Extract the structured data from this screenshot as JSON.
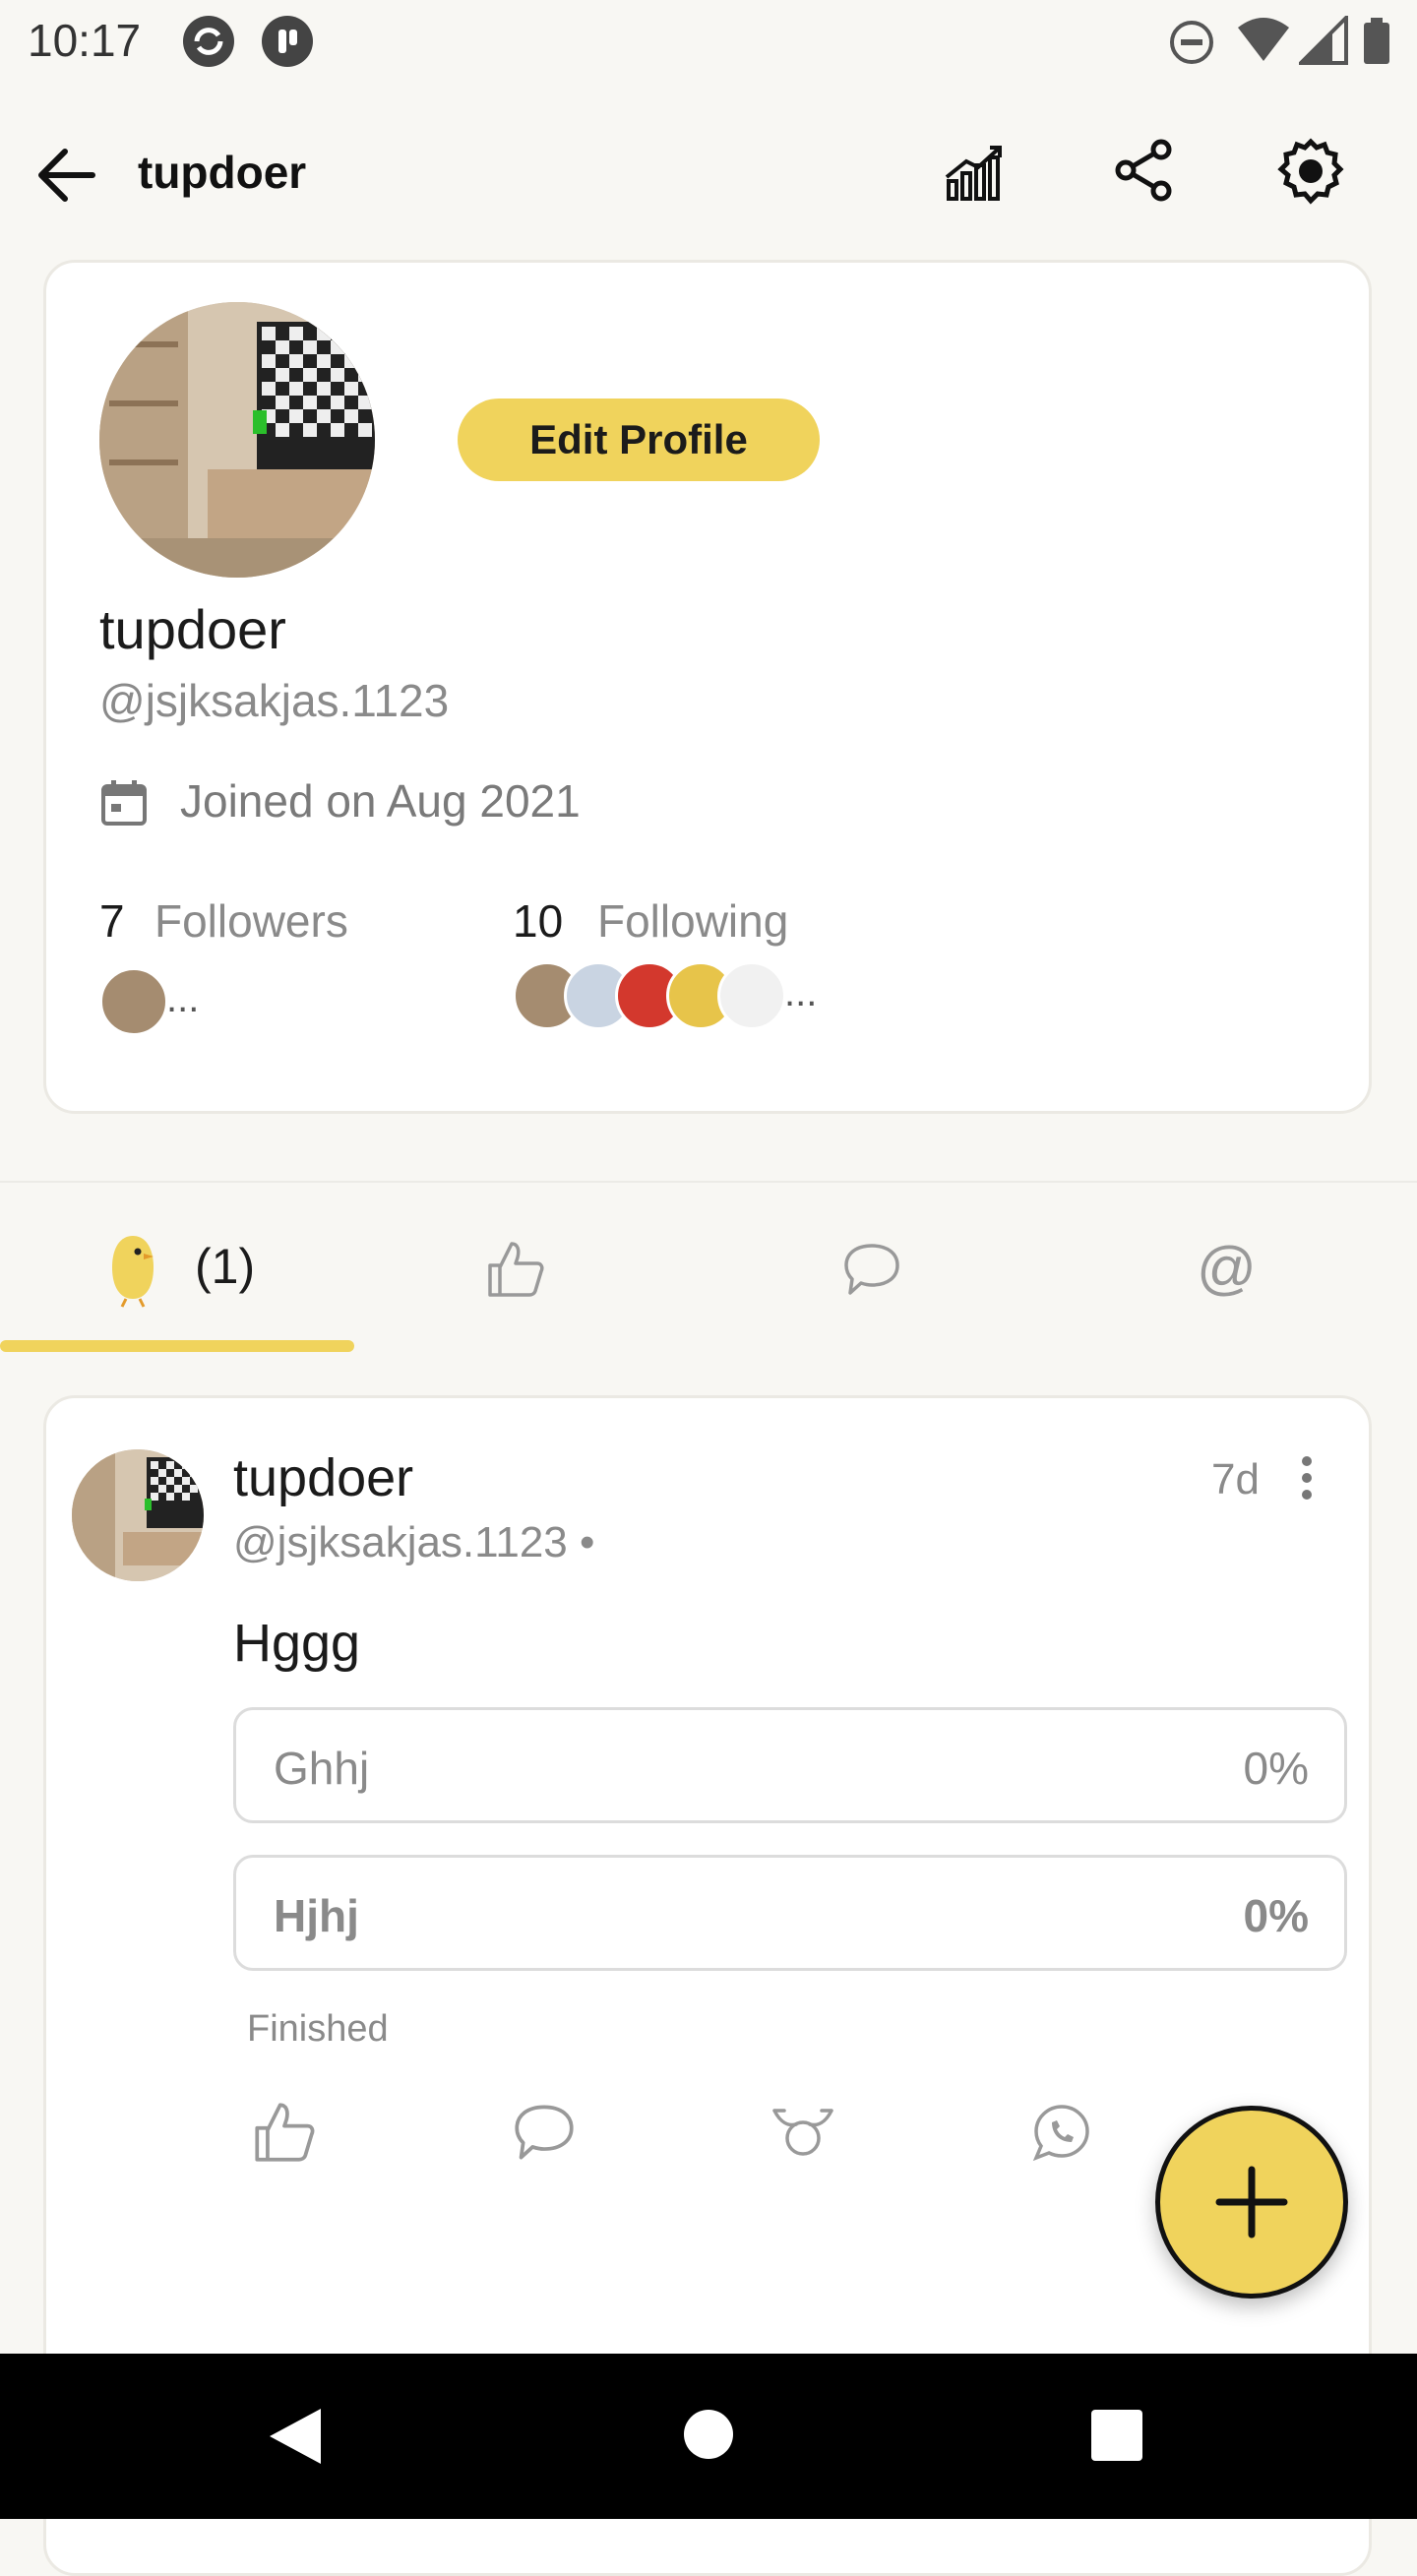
{
  "status_bar": {
    "time": "10:17"
  },
  "header": {
    "title": "tupdoer"
  },
  "profile": {
    "edit_button": "Edit Profile",
    "name": "tupdoer",
    "handle": "@jsjksakjas.1123",
    "joined": "Joined on Aug 2021",
    "followers_count": "7",
    "followers_label": "Followers",
    "following_count": "10",
    "following_label": "Following",
    "ellipsis": "..."
  },
  "tabs": {
    "posts_count": "(1)"
  },
  "post": {
    "author": "tupdoer",
    "handle": "@jsjksakjas.1123 •",
    "time": "7d",
    "text": "Hggg",
    "poll": [
      {
        "label": "Ghhj",
        "percent": "0%"
      },
      {
        "label": "Hjhj",
        "percent": "0%"
      }
    ],
    "poll_status": "Finished"
  },
  "colors": {
    "accent": "#f0d35c",
    "background": "#f8f7f3",
    "card": "#ffffff",
    "muted": "#8a8a8a"
  },
  "icons": [
    "back-arrow-icon",
    "analytics-icon",
    "share-icon",
    "settings-gear-icon",
    "calendar-icon",
    "koo-bird-icon",
    "like-icon",
    "comment-icon",
    "mention-icon",
    "more-vertical-icon",
    "rekoo-icon",
    "whatsapp-icon",
    "plus-icon"
  ]
}
